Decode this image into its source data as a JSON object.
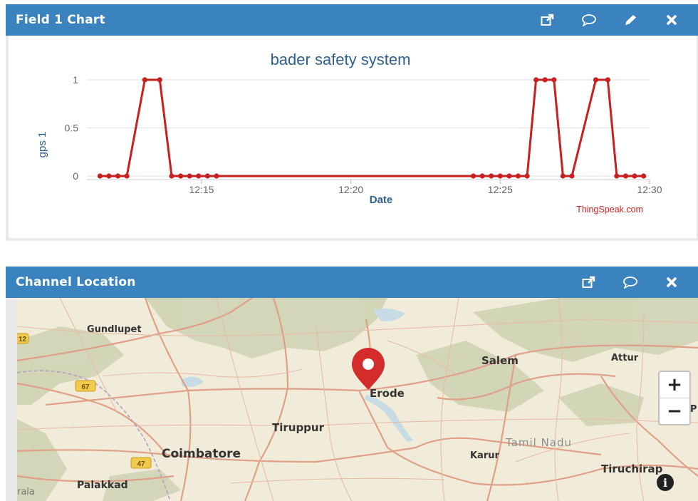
{
  "chart_panel": {
    "title": "Field 1 Chart",
    "icons": [
      "external-link-icon",
      "comment-icon",
      "edit-icon",
      "close-icon"
    ]
  },
  "chart_data": {
    "type": "line",
    "title": "bader safety system",
    "xlabel": "Date",
    "ylabel": "gps 1",
    "credit": "ThingSpeak.com",
    "x_ticks": [
      "12:15",
      "12:20",
      "12:25",
      "12:30"
    ],
    "y_ticks": [
      "0",
      "0.5",
      "1"
    ],
    "ylim": [
      0,
      1
    ],
    "xlim": [
      "12:11:24",
      "12:30:00"
    ],
    "grid": true,
    "color": "#c62020",
    "series": [
      {
        "points": [
          [
            "12:11:36",
            0
          ],
          [
            "12:11:54",
            0
          ],
          [
            "12:12:12",
            0
          ],
          [
            "12:12:30",
            0
          ],
          [
            "12:13:06",
            1
          ],
          [
            "12:13:36",
            1
          ],
          [
            "12:14:00",
            0
          ],
          [
            "12:14:18",
            0
          ],
          [
            "12:14:36",
            0
          ],
          [
            "12:14:54",
            0
          ],
          [
            "12:15:12",
            0
          ],
          [
            "12:15:30",
            0
          ],
          [
            "12:24:06",
            0
          ],
          [
            "12:24:24",
            0
          ],
          [
            "12:24:42",
            0
          ],
          [
            "12:25:00",
            0
          ],
          [
            "12:25:18",
            0
          ],
          [
            "12:25:36",
            0
          ],
          [
            "12:25:54",
            0
          ],
          [
            "12:26:12",
            1
          ],
          [
            "12:26:30",
            1
          ],
          [
            "12:26:48",
            1
          ],
          [
            "12:27:06",
            0
          ],
          [
            "12:27:24",
            0
          ],
          [
            "12:28:12",
            1
          ],
          [
            "12:28:36",
            1
          ],
          [
            "12:28:54",
            0
          ],
          [
            "12:29:12",
            0
          ],
          [
            "12:29:30",
            0
          ],
          [
            "12:29:48",
            0
          ]
        ]
      }
    ]
  },
  "map_panel": {
    "title": "Channel Location",
    "icons": [
      "external-link-icon",
      "comment-icon",
      "close-icon"
    ],
    "labels": {
      "gundlupet": "Gundlupet",
      "salem": "Salem",
      "attur": "Attur",
      "erode": "Erode",
      "tiruppur": "Tiruppur",
      "tamil_nadu": "Tamil Nadu",
      "coimbatore": "Coimbatore",
      "karur": "Karur",
      "palakkad": "Palakkad",
      "tiruchirap": "Tiruchirap",
      "kerala_fragment": "rala",
      "pe_fragment": "P"
    },
    "shields": [
      "12",
      "67",
      "47"
    ],
    "zoom_in_label": "+",
    "zoom_out_label": "−",
    "info_label": "i",
    "marker_icon": "location-pin-icon",
    "colors": {
      "marker": "#d42b2b",
      "roads": "#e2a28a",
      "land": "#f1ecd9",
      "hills": "#cfd4b4",
      "water": "#c6dbe4"
    }
  }
}
